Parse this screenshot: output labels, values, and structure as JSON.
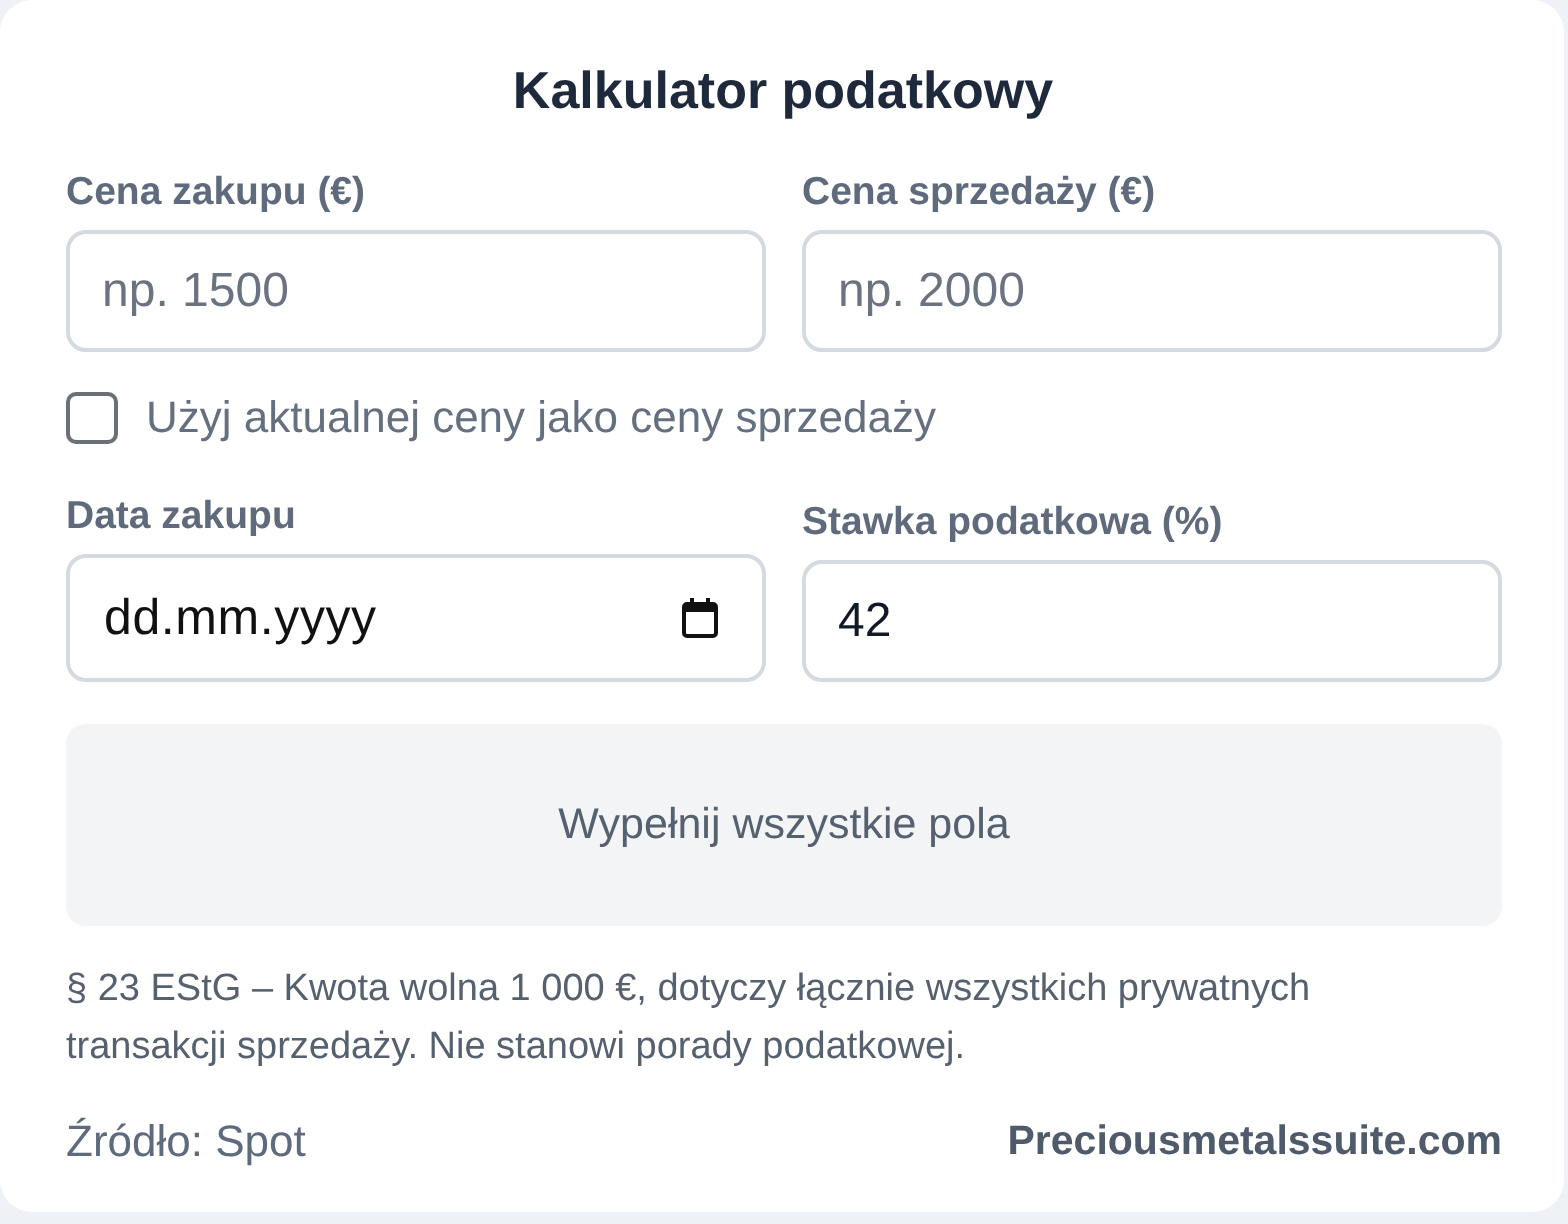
{
  "title": "Kalkulator podatkowy",
  "price_fields": [
    {
      "kind": "number",
      "label": "Cena zakupu (€)",
      "placeholder": "np. 1500"
    },
    {
      "kind": "number",
      "label": "Cena sprzedaży (€)",
      "placeholder": "np. 2000"
    }
  ],
  "checkbox": {
    "label": "Użyj aktualnej ceny jako ceny sprzedaży",
    "checked": false
  },
  "detail_fields": [
    {
      "kind": "date",
      "label": "Data zakupu",
      "placeholder": "dd.mm.yyyy"
    },
    {
      "kind": "number",
      "label": "Stawka podatkowa (%)",
      "value": "42"
    }
  ],
  "result": {
    "message": "Wypełnij wszystkie pola"
  },
  "note": "§ 23 EStG – Kwota wolna 1 000 €, dotyczy łącznie wszystkich prywatnych transakcji sprzedaży. Nie stanowi porady podatkowej.",
  "footer": {
    "source": "Źródło: Spot",
    "link": "Preciousmetalssuite.com"
  }
}
